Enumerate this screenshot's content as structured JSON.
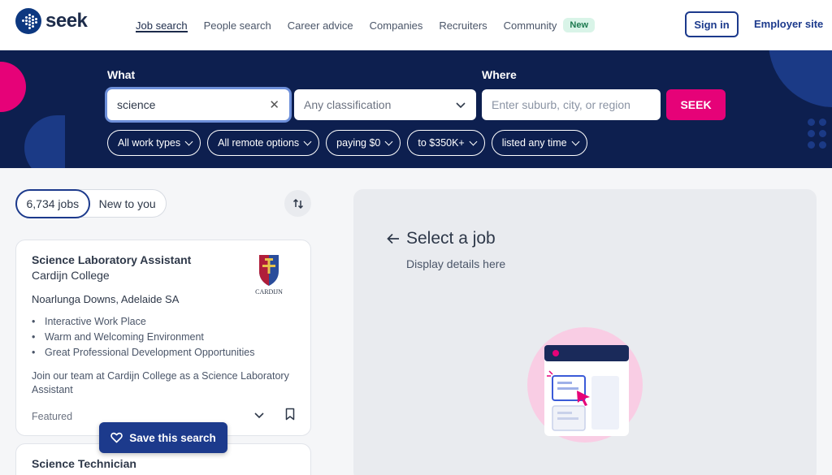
{
  "brand": {
    "name": "seek",
    "accent": "#e60278",
    "primary": "#1c3a8c",
    "hero_bg": "#0d1f4f"
  },
  "nav": {
    "items": [
      {
        "label": "Job search",
        "active": true
      },
      {
        "label": "People search"
      },
      {
        "label": "Career advice"
      },
      {
        "label": "Companies"
      },
      {
        "label": "Recruiters"
      },
      {
        "label": "Community"
      }
    ],
    "badge": "New",
    "sign_in": "Sign in",
    "employer": "Employer site"
  },
  "search": {
    "what_label": "What",
    "what_value": "science",
    "classification_placeholder": "Any classification",
    "where_label": "Where",
    "where_placeholder": "Enter suburb, city, or region",
    "submit": "SEEK",
    "filters": [
      "All work types",
      "All remote options",
      "paying $0",
      "to $350K+",
      "listed any time"
    ]
  },
  "results": {
    "count_label": "6,734 jobs",
    "new_label": "New to you",
    "save_search": "Save this search",
    "jobs": [
      {
        "title": "Science Laboratory Assistant",
        "company": "Cardijn College",
        "logo_text": "CARDIJN",
        "location": "Noarlunga Downs, Adelaide SA",
        "bullets": [
          "Interactive Work Place",
          "Warm and Welcoming Environment",
          "Great Professional Development Opportunities"
        ],
        "teaser": "Join our team at Cardijn College as a Science Laboratory Assistant",
        "tag": "Featured"
      },
      {
        "title": "Science Technician"
      }
    ]
  },
  "detail": {
    "title": "Select a job",
    "subtitle": "Display details here"
  }
}
